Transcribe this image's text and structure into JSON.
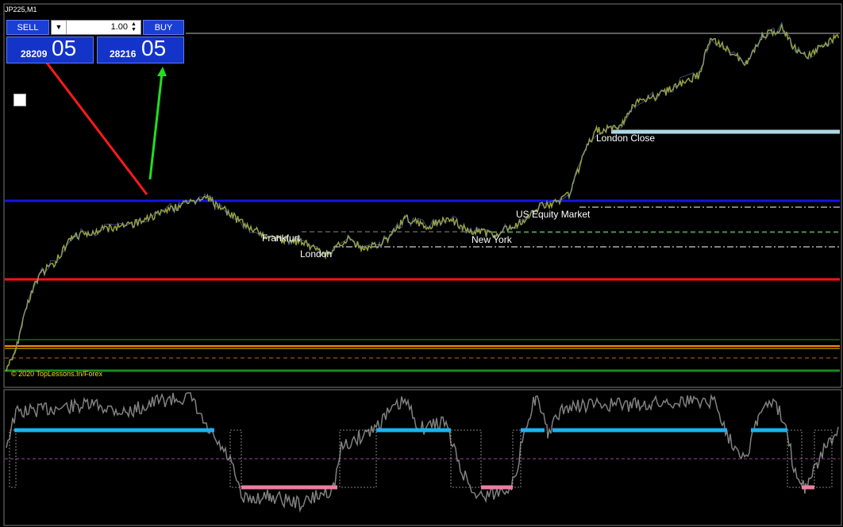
{
  "chart": {
    "symbol": "JP225,M1",
    "copyright": "© 2020 TopLessons.In/Forex",
    "colors": {
      "background": "#000000",
      "candles": "#9aa23a",
      "blue_line": "#1414e6",
      "red_line": "#ff1414",
      "orange_line": "#ff8c00",
      "green_line": "#1a8a1a",
      "light_blue_line": "#add8e6",
      "oscillator": "#808080",
      "bull_segment": "#1fb0f0",
      "bear_segment": "#e87ea0"
    }
  },
  "trade_panel": {
    "sell_label": "SELL",
    "buy_label": "BUY",
    "lot_value": "1.00",
    "sell_price_small": "28209",
    "sell_price_big": "05",
    "buy_price_small": "28216",
    "buy_price_big": "05"
  },
  "sessions": {
    "frankfurt": "Frankfurt",
    "london": "London",
    "new_york": "New York",
    "us_equity": "US Equity Market",
    "london_close": "London Close"
  },
  "icons": [
    "arrow-red",
    "arrow-green",
    "checkbox"
  ]
}
